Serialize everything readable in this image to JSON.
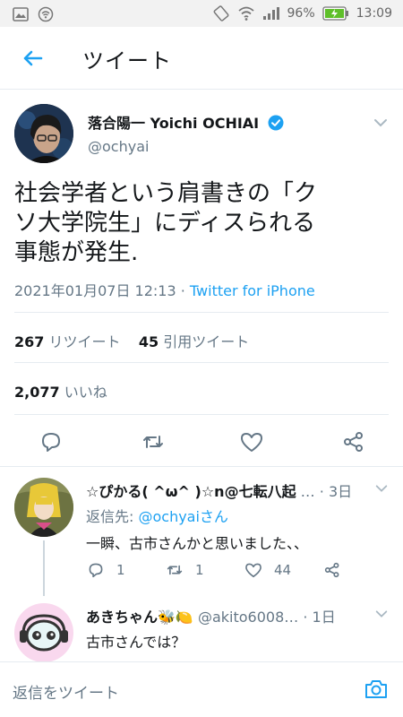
{
  "status_bar": {
    "battery": "96%",
    "time": "13:09"
  },
  "header": {
    "title": "ツイート"
  },
  "tweet": {
    "author_name": "落合陽一 Yoichi OCHIAI",
    "handle": "@ochyai",
    "text": "社会学者という肩書きの「ク\nソ大学院生」にディスられる\n事態が発生.",
    "date": "2021年01月07日 12:13",
    "source": "Twitter for iPhone",
    "retweet_count": "267",
    "retweet_label": "リツイート",
    "quote_count": "45",
    "quote_label": "引用ツイート",
    "like_count": "2,077",
    "like_label": "いいね"
  },
  "replies": [
    {
      "name": "☆ぴかる( ^ω^ )☆n@七転八起",
      "handle": "…",
      "time": "· 3日",
      "reply_to_prefix": "返信先: ",
      "reply_to_mention": "@ochyaiさん",
      "text": "一瞬、古市さんかと思いました、、",
      "reply_count": "1",
      "retweet_count": "1",
      "like_count": "44"
    },
    {
      "name": "あきちゃん🐝🍋",
      "handle": "@akito6008…",
      "time": "· 1日",
      "text": "古市さんでは？"
    }
  ],
  "composer": {
    "placeholder": "返信をツイート"
  },
  "colors": {
    "accent": "#1da1f2",
    "secondary_text": "#657786",
    "divider": "#e6ecf0"
  }
}
